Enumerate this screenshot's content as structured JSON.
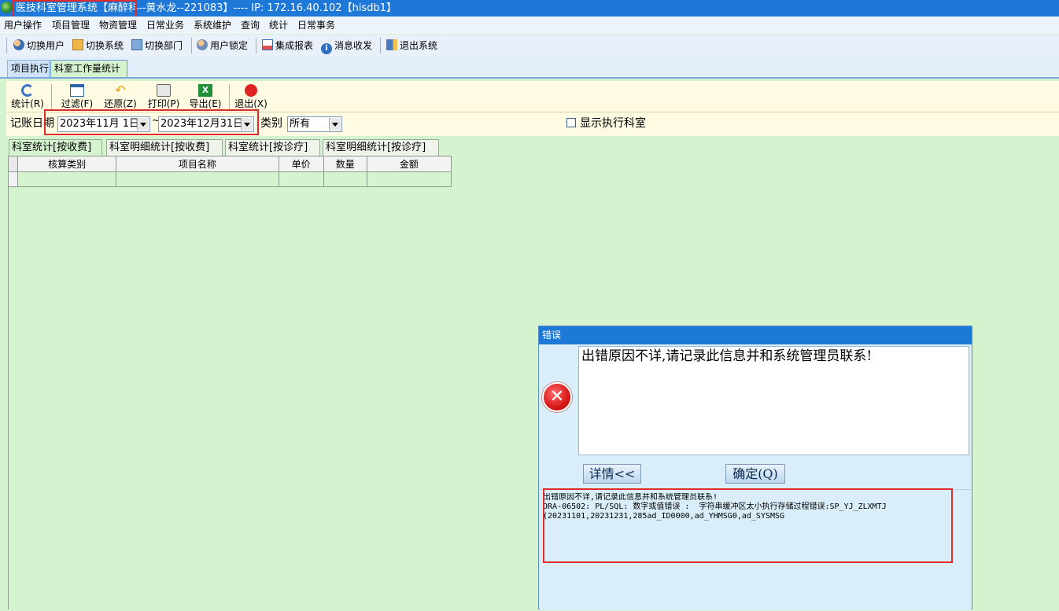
{
  "window": {
    "title": "医技科室管理系统【麻醉科--黄水龙--221083】---- IP: 172.16.40.102【hisdb1】"
  },
  "menubar": [
    "用户操作",
    "项目管理",
    "物资管理",
    "日常业务",
    "系统维护",
    "查询",
    "统计",
    "日常事务"
  ],
  "toolbar": [
    "切换用户",
    "切换系统",
    "切换部门",
    "用户锁定",
    "集成报表",
    "消息收发",
    "退出系统"
  ],
  "tabs": [
    "项目执行",
    "科室工作量统计"
  ],
  "panel_toolbar": [
    "统计(R)",
    "过滤(F)",
    "还原(Z)",
    "打印(P)",
    "导出(E)",
    "退出(X)"
  ],
  "filter": {
    "date_label": "记账日期",
    "start_date": "2023年11月 1日",
    "separator": "~",
    "end_date": "2023年12月31日",
    "category_label": "类别",
    "category_value": "所有",
    "show_exec_dept": "显示执行科室"
  },
  "subtabs": [
    "科室统计[按收费]",
    "科室明细统计[按收费]",
    "科室统计[按诊疗]",
    "科室明细统计[按诊疗]"
  ],
  "grid": {
    "columns": [
      "核算类别",
      "项目名称",
      "单价",
      "数量",
      "金额"
    ]
  },
  "error_dialog": {
    "title": "错误",
    "message": "出错原因不详,请记录此信息并和系统管理员联系!",
    "details_button": "详情<<",
    "ok_button": "确定(Q)",
    "detail_text": "出错原因不详,请记录此信息并和系统管理员联系!\nORA-06502: PL/SQL: 数字或值错误 :  字符串缓冲区太小执行存储过程错误:SP_YJ_ZLXMTJ\n(20231101,20231231,285ad_ID0000,ad_YHMSG0,ad_SYSMSG"
  },
  "colors": {
    "title_bar": "#1e78d7",
    "highlight_box": "#e02b2b",
    "background": "#d6f3cf",
    "toolbar_bg": "#fffbe2"
  }
}
